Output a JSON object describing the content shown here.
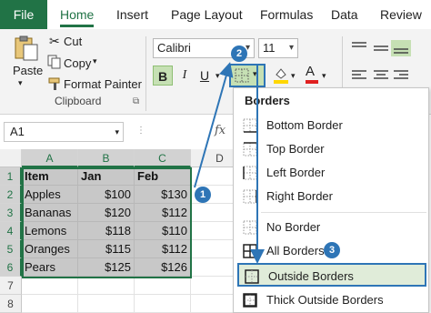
{
  "tabs": {
    "file": "File",
    "items": [
      "Home",
      "Insert",
      "Page Layout",
      "Formulas",
      "Data",
      "Review"
    ],
    "active": "Home"
  },
  "clipboard": {
    "paste": "Paste",
    "cut": "Cut",
    "copy": "Copy",
    "format_painter": "Format Painter",
    "group_label": "Clipboard"
  },
  "font": {
    "name": "Calibri",
    "size": "11",
    "bold": "B",
    "italic": "I",
    "underline": "U"
  },
  "formula_bar": {
    "name_box": "A1",
    "fx": "fx"
  },
  "grid": {
    "columns": [
      "A",
      "B",
      "C",
      "D"
    ],
    "rows": [
      "1",
      "2",
      "3",
      "4",
      "5",
      "6",
      "7",
      "8"
    ],
    "header_row": [
      "Item",
      "Jan",
      "Feb"
    ],
    "data": [
      [
        "Apples",
        "$100",
        "$130"
      ],
      [
        "Bananas",
        "$120",
        "$112"
      ],
      [
        "Lemons",
        "$118",
        "$110"
      ],
      [
        "Oranges",
        "$115",
        "$112"
      ],
      [
        "Pears",
        "$125",
        "$126"
      ]
    ]
  },
  "borders_menu": {
    "title": "Borders",
    "items": [
      {
        "label": "Bottom Border",
        "icon": "bottom-border-icon"
      },
      {
        "label": "Top Border",
        "icon": "top-border-icon"
      },
      {
        "label": "Left Border",
        "icon": "left-border-icon"
      },
      {
        "label": "Right Border",
        "icon": "right-border-icon"
      },
      {
        "label": "No Border",
        "icon": "no-border-icon"
      },
      {
        "label": "All Borders",
        "icon": "all-borders-icon"
      },
      {
        "label": "Outside Borders",
        "icon": "outside-borders-icon"
      },
      {
        "label": "Thick Outside Borders",
        "icon": "thick-outside-borders-icon"
      }
    ],
    "highlighted": "Outside Borders"
  },
  "step_badges": [
    "1",
    "2",
    "3"
  ],
  "colors": {
    "excel_green": "#217346",
    "selection_fill": "#c8c8c8",
    "callout_blue": "#2e75b6",
    "font_color_red": "#e02020",
    "fill_yellow": "#ffd700"
  }
}
